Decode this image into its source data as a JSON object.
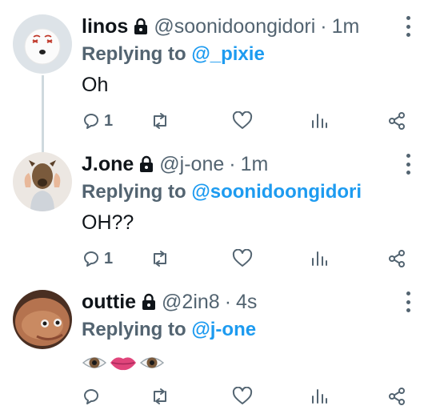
{
  "tweets": [
    {
      "name": "linos",
      "handle": "@soonidoongidori",
      "separator": "·",
      "time": "1m",
      "replying_prefix": "Replying to",
      "replying_to": "@_pixie",
      "text": "Oh",
      "reply_count": "1",
      "avatar": "cartoon-character-avatar"
    },
    {
      "name": "J.one",
      "handle": "@j-one",
      "separator": "·",
      "time": "1m",
      "replying_prefix": "Replying to",
      "replying_to": "@soonidoongidori",
      "text": "OH??",
      "reply_count": "1",
      "avatar": "dog-mask-avatar"
    },
    {
      "name": "outtie",
      "handle": "@2in8",
      "separator": "·",
      "time": "4s",
      "replying_prefix": "Replying to",
      "replying_to": "@j-one",
      "text": "",
      "reply_count": "",
      "emoji": [
        "eye-emoji",
        "lips-emoji",
        "eye-emoji"
      ],
      "avatar": "face-closeup-avatar"
    }
  ],
  "colors": {
    "link": "#1d9bf0",
    "secondary": "#536471",
    "thread_line": "#cfd9de",
    "icon": "#536471"
  },
  "icons": [
    "lock-icon",
    "more-icon",
    "reply-icon",
    "retweet-icon",
    "like-icon",
    "analytics-icon",
    "share-icon"
  ]
}
